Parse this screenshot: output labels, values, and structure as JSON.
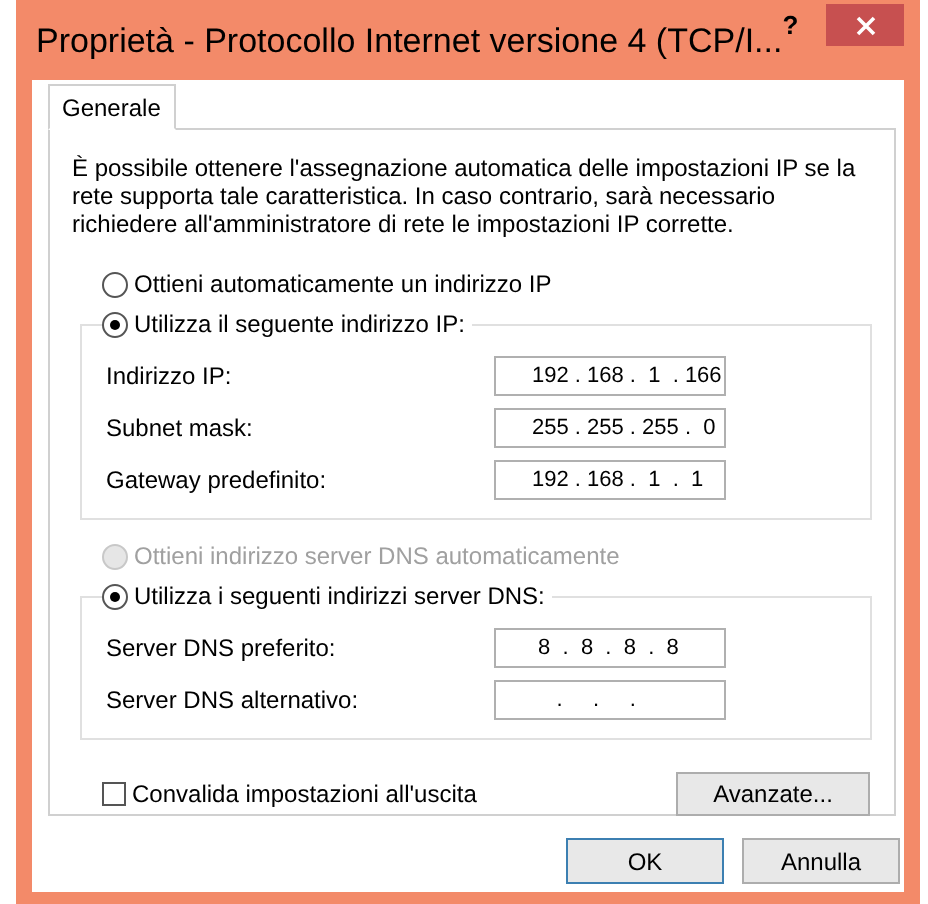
{
  "window": {
    "title": "Proprietà - Protocollo Internet versione 4 (TCP/I...",
    "help": "?"
  },
  "tabs": [
    {
      "label": "Generale",
      "selected": true
    }
  ],
  "description": "È possibile ottenere l'assegnazione automatica delle impostazioni IP se la rete supporta tale caratteristica. In caso contrario, sarà necessario richiedere all'amministratore di rete le impostazioni IP corrette.",
  "ip_section": {
    "options": [
      {
        "label": "Ottieni automaticamente un indirizzo IP",
        "selected": false,
        "disabled": false
      },
      {
        "label": "Utilizza il seguente indirizzo IP:",
        "selected": true,
        "disabled": false
      }
    ],
    "fields": [
      {
        "label": "Indirizzo IP:",
        "value": "192 . 168 .  1  . 166"
      },
      {
        "label": "Subnet mask:",
        "value": "255 . 255 . 255 .  0"
      },
      {
        "label": "Gateway predefinito:",
        "value": "192 . 168 .  1  .  1"
      }
    ]
  },
  "dns_section": {
    "options": [
      {
        "label": "Ottieni indirizzo server DNS automaticamente",
        "selected": false,
        "disabled": true
      },
      {
        "label": "Utilizza i seguenti indirizzi server DNS:",
        "selected": true,
        "disabled": false
      }
    ],
    "fields": [
      {
        "label": "Server DNS preferito:",
        "value": " 8  .  8  .  8  .  8"
      },
      {
        "label": "Server DNS alternativo:",
        "value": "    .     .     ."
      }
    ]
  },
  "validate_checkbox": {
    "label": "Convalida impostazioni all'uscita",
    "checked": false
  },
  "advanced_button": "Avanzate...",
  "buttons": [
    {
      "label": "OK",
      "default": true
    },
    {
      "label": "Annulla",
      "default": false
    }
  ]
}
